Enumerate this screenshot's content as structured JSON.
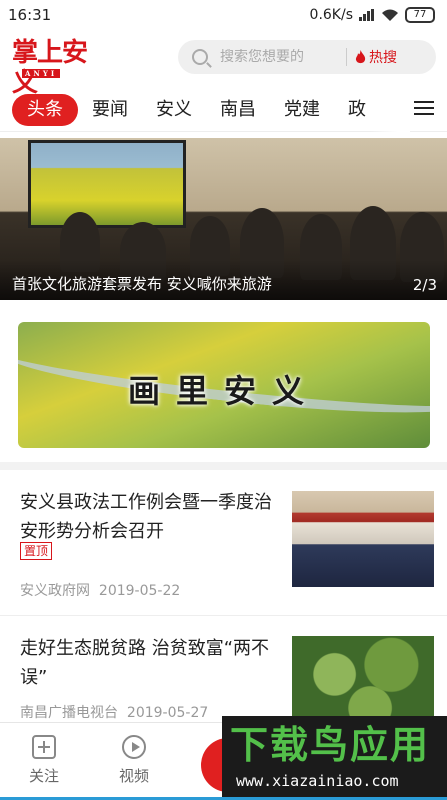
{
  "status_bar": {
    "time": "16:31",
    "network_speed": "0.6K/s",
    "battery": "77"
  },
  "header": {
    "logo_text": "掌上安义",
    "logo_subtext": "ANYI",
    "search_placeholder": "搜索您想要的",
    "hot_search_label": "热搜"
  },
  "tabs": [
    {
      "label": "头条",
      "active": true
    },
    {
      "label": "要闻",
      "active": false
    },
    {
      "label": "安义",
      "active": false
    },
    {
      "label": "南昌",
      "active": false
    },
    {
      "label": "党建",
      "active": false
    },
    {
      "label": "政",
      "active": false
    }
  ],
  "banner": {
    "caption": "首张文化旅游套票发布 安义喊你来旅游",
    "counter": "2/3"
  },
  "ad_banner": {
    "title": "画里安义"
  },
  "news": [
    {
      "title": "安义县政法工作例会暨一季度治安形势分析会召开",
      "tag": "置顶",
      "source": "安义政府网",
      "date": "2019-05-22"
    },
    {
      "title": "走好生态脱贫路 治贫致富“两不误”",
      "tag": "",
      "source": "南昌广播电视台",
      "date": "2019-05-27"
    }
  ],
  "tab_bar": {
    "items": [
      {
        "label": "关注",
        "icon": "add-follow-icon"
      },
      {
        "label": "视频",
        "icon": "play-icon"
      }
    ],
    "center_button": "言"
  },
  "watermark": {
    "text": "下载鸟应用",
    "url": "www.xiazainiao.com"
  },
  "colors": {
    "accent": "#e02020",
    "watermark_green": "#53c04a"
  }
}
